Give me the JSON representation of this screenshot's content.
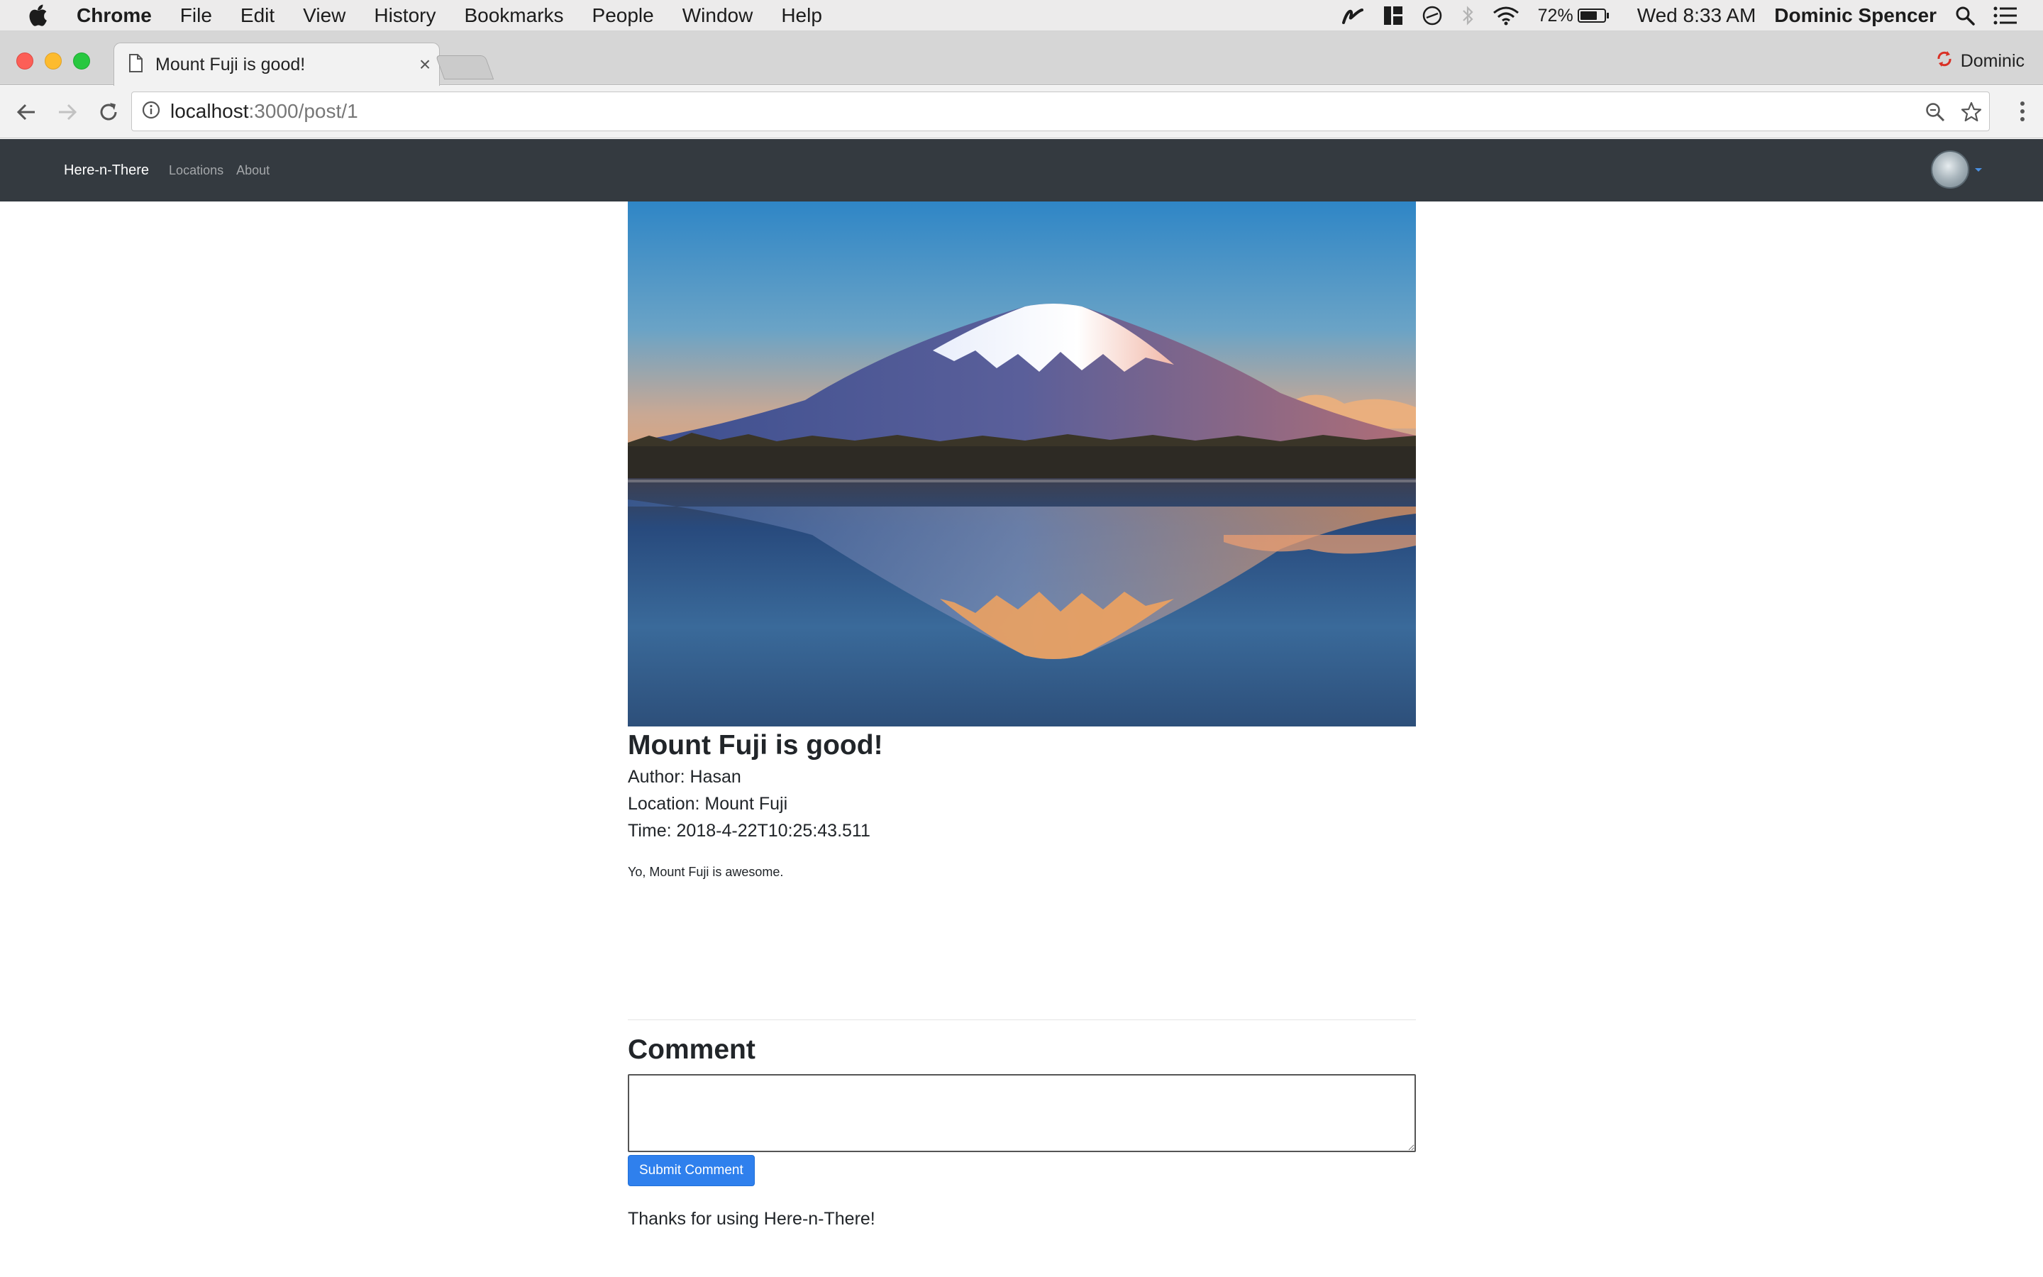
{
  "menubar": {
    "app_name": "Chrome",
    "items": [
      "File",
      "Edit",
      "View",
      "History",
      "Bookmarks",
      "People",
      "Window",
      "Help"
    ],
    "battery": "72%",
    "battery_level": 0.72,
    "clock": "Wed 8:33 AM",
    "user": "Dominic Spencer"
  },
  "browser": {
    "tab_title": "Mount Fuji is good!",
    "profile_name": "Dominic",
    "url_host": "localhost",
    "url_path": ":3000/post/1"
  },
  "navbar": {
    "brand": "Here-n-There",
    "links": [
      "Locations",
      "About"
    ]
  },
  "post": {
    "title": "Mount Fuji is good!",
    "author": "Author: Hasan",
    "location": "Location: Mount Fuji",
    "time": "Time: 2018-4-22T10:25:43.511",
    "body": "Yo, Mount Fuji is awesome."
  },
  "comment": {
    "heading": "Comment",
    "submit_label": "Submit Comment",
    "textarea_value": ""
  },
  "footer": {
    "thanks": "Thanks for using Here-n-There!"
  },
  "colors": {
    "navbar_bg": "#343a40",
    "primary": "#2f80ed"
  }
}
